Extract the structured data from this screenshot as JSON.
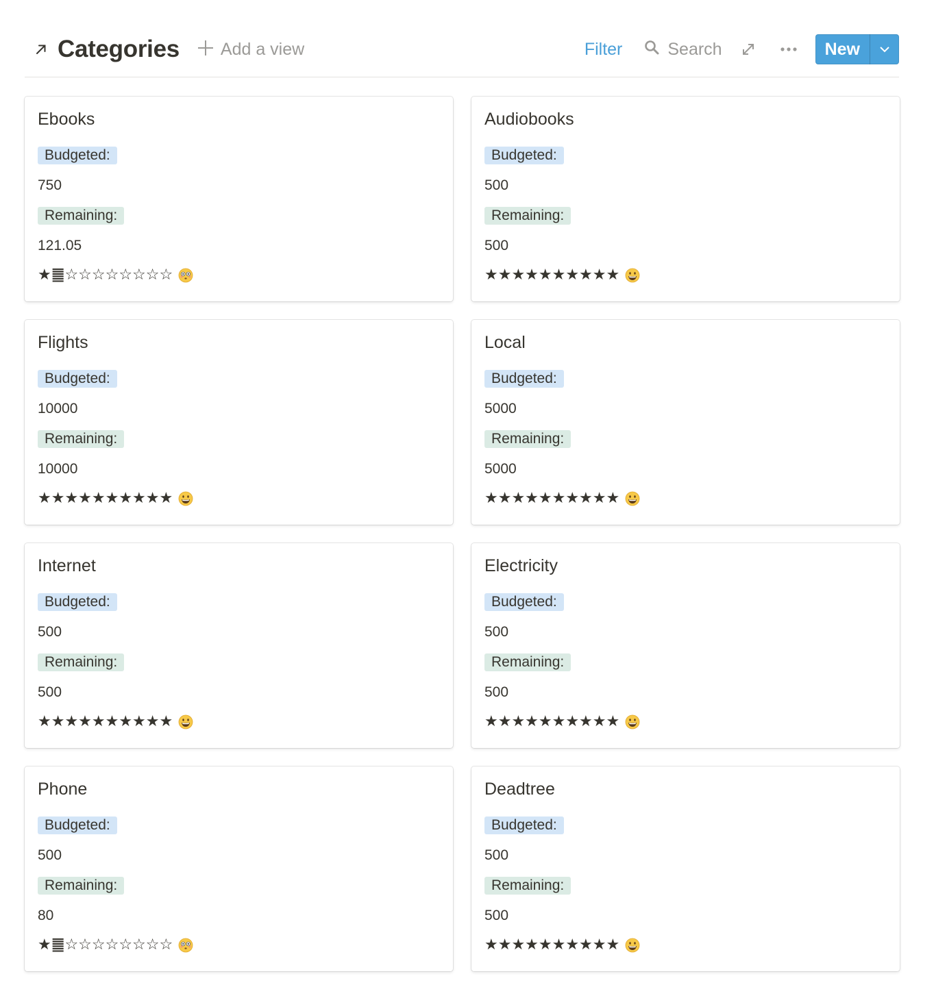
{
  "header": {
    "title": "Categories",
    "add_view": "Add a view",
    "filter": "Filter",
    "search": "Search",
    "new": "New"
  },
  "colors": {
    "accent": "#4aa2db",
    "filter": "#4a9fd8",
    "budget_tag": "#d3e5f7",
    "remaining_tag": "#dbebe4"
  },
  "icons": {
    "title": "arrow-up-right-icon",
    "add": "plus-icon",
    "search": "search-icon",
    "expand": "expand-icon",
    "more": "more-horizontal-icon",
    "new_dropdown": "chevron-down-icon"
  },
  "cards": [
    {
      "title": "Ebooks",
      "budgeted_label": "Budgeted:",
      "budgeted": "750",
      "remaining_label": "Remaining:",
      "remaining": "121.05",
      "rating": "★䷀☆☆☆☆☆☆☆☆",
      "mood": "flushed"
    },
    {
      "title": "Audiobooks",
      "budgeted_label": "Budgeted:",
      "budgeted": "500",
      "remaining_label": "Remaining:",
      "remaining": "500",
      "rating": "★★★★★★★★★★",
      "mood": "grinning"
    },
    {
      "title": "Flights",
      "budgeted_label": "Budgeted:",
      "budgeted": "10000",
      "remaining_label": "Remaining:",
      "remaining": "10000",
      "rating": "★★★★★★★★★★",
      "mood": "grinning"
    },
    {
      "title": "Local",
      "budgeted_label": "Budgeted:",
      "budgeted": "5000",
      "remaining_label": "Remaining:",
      "remaining": "5000",
      "rating": "★★★★★★★★★★",
      "mood": "grinning"
    },
    {
      "title": "Internet",
      "budgeted_label": "Budgeted:",
      "budgeted": "500",
      "remaining_label": "Remaining:",
      "remaining": "500",
      "rating": "★★★★★★★★★★",
      "mood": "grinning"
    },
    {
      "title": "Electricity",
      "budgeted_label": "Budgeted:",
      "budgeted": "500",
      "remaining_label": "Remaining:",
      "remaining": "500",
      "rating": "★★★★★★★★★★",
      "mood": "grinning"
    },
    {
      "title": "Phone",
      "budgeted_label": "Budgeted:",
      "budgeted": "500",
      "remaining_label": "Remaining:",
      "remaining": "80",
      "rating": "★䷀☆☆☆☆☆☆☆☆",
      "mood": "flushed"
    },
    {
      "title": "Deadtree",
      "budgeted_label": "Budgeted:",
      "budgeted": "500",
      "remaining_label": "Remaining:",
      "remaining": "500",
      "rating": "★★★★★★★★★★",
      "mood": "grinning"
    }
  ]
}
